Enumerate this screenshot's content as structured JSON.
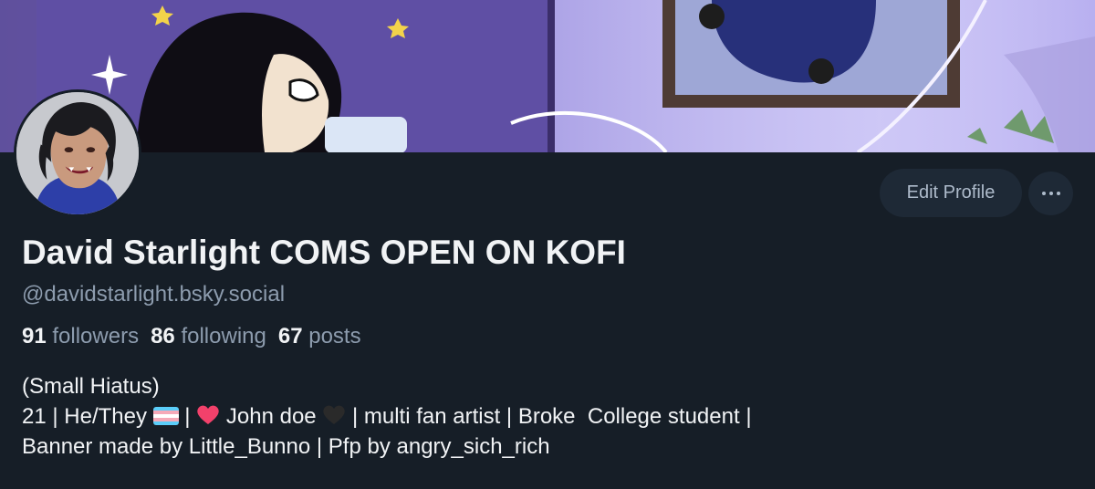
{
  "profile": {
    "display_name": "David Starlight COMS OPEN ON KOFI",
    "handle": "@davidstarlight.bsky.social",
    "stats": {
      "followers_count": "91",
      "followers_label": "followers",
      "following_count": "86",
      "following_label": "following",
      "posts_count": "67",
      "posts_label": "posts"
    },
    "bio": {
      "line1": "(Small Hiatus)",
      "line2_part1": "21 | He/They",
      "line2_part2": " | ",
      "line2_part3": " John doe ",
      "line2_part4": " | multi fan artist | Broke  College student |",
      "line3": "Banner made by Little_Bunno | Pfp by angry_sich_rich"
    }
  },
  "actions": {
    "edit_profile_label": "Edit Profile",
    "more_icon": "ellipsis-icon"
  },
  "colors": {
    "background": "#161e27",
    "button_bg": "#1e2936",
    "text_primary": "#f1f3f5",
    "text_secondary": "#8d9cae"
  }
}
